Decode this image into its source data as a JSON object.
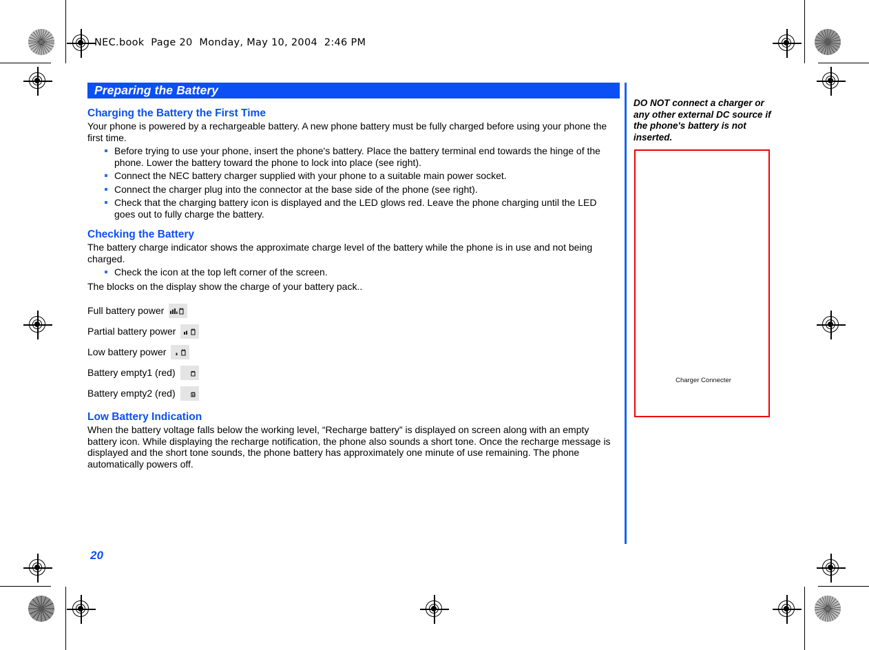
{
  "header": {
    "book_line": "NEC.book  Page 20  Monday, May 10, 2004  2:46 PM"
  },
  "section": {
    "title": "Preparing the Battery"
  },
  "main": {
    "subsections": [
      {
        "heading": "Charging the Battery the First Time",
        "intro": "Your phone is powered by a rechargeable battery. A new phone battery must be fully charged before using your phone the first time.",
        "bullets": [
          "Before trying to use your phone, insert the phone's battery. Place the battery terminal end towards the hinge of the phone. Lower the battery toward the phone to lock into place (see right).",
          "Connect the NEC battery charger supplied with your phone to a suitable main power socket.",
          "Connect the charger plug into the connector at the base side of the phone (see right).",
          "Check that the charging battery icon is displayed and the LED glows red. Leave the phone charging until the LED goes out to fully charge the battery."
        ]
      },
      {
        "heading": "Checking the Battery",
        "intro": "The battery charge indicator shows the approximate charge level of the battery while the phone is in use and not being charged.",
        "bullets": [
          "Check the icon at the top left corner of the screen."
        ],
        "outro": "The blocks on the display show the charge of your battery pack.."
      },
      {
        "heading": "Low Battery Indication",
        "intro": "When the battery voltage falls below the working level, “Recharge battery” is displayed on screen along with an empty battery icon. While displaying the recharge notification, the phone also sounds a short tone. Once the recharge message is displayed and the short tone sounds, the phone battery has approximately one minute of use remaining. The phone automatically powers off."
      }
    ],
    "battery_levels": [
      {
        "label": "Full battery power",
        "icon": "battery-full-icon",
        "bars": 4,
        "battery_fill": 1.0
      },
      {
        "label": "Partial battery power",
        "icon": "battery-partial-icon",
        "bars": 2,
        "battery_fill": 0.75
      },
      {
        "label": "Low battery power",
        "icon": "battery-low-icon",
        "bars": 1,
        "battery_fill": 0.5
      },
      {
        "label": "Battery empty1 (red)",
        "icon": "battery-empty1-icon",
        "bars": 0,
        "battery_fill": 0.25
      },
      {
        "label": "Battery empty2 (red)",
        "icon": "battery-empty2-icon",
        "bars": 0,
        "battery_fill": 0.0
      }
    ]
  },
  "sidebar": {
    "warning": "DO NOT connect a charger or any other external DC source if the phone's battery is not inserted.",
    "figure_caption": "Charger Connecter"
  },
  "footer": {
    "page_number": "20"
  },
  "colors": {
    "accent_blue": "#0b4ff5",
    "bullet_blue": "#2a6ef5",
    "figure_border_red": "#f00000",
    "swatch_gray": "#e4e4e4"
  }
}
